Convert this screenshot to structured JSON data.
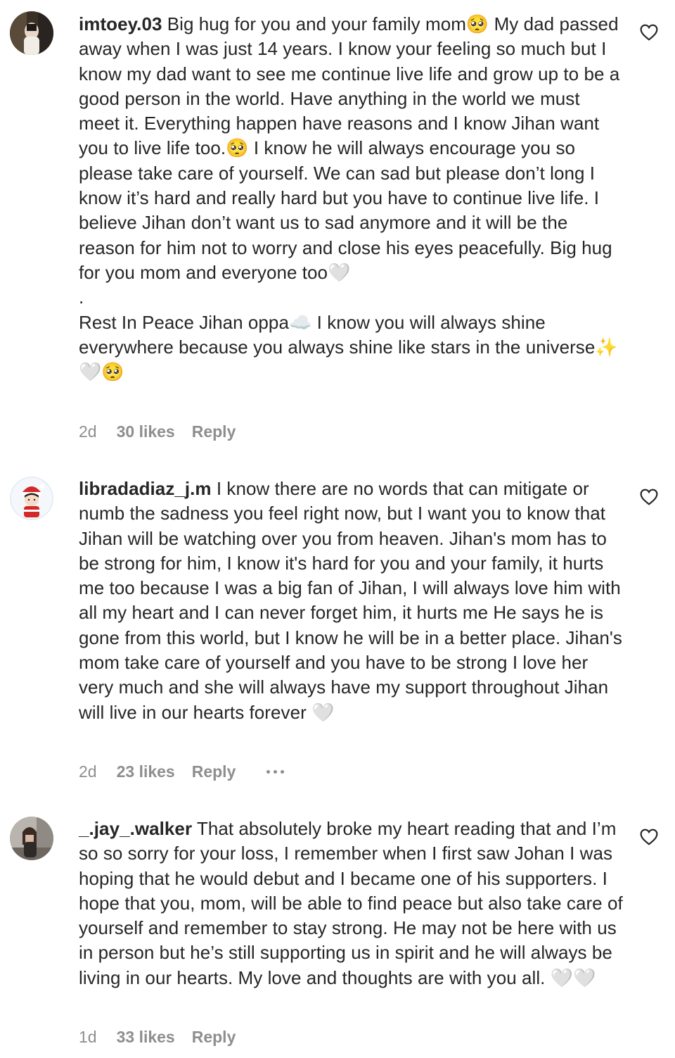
{
  "comments": [
    {
      "username": "imtoey.03",
      "body": " Big hug for you and your family mom🥺 My dad passed away when I was just 14 years. I know your feeling so much but I know my dad want to see me continue live life and grow up to be a good person in the world. Have anything in the world we must meet it. Everything happen have reasons and I know Jihan want you to live life too.🥺 I know he will always encourage you so please take care of yourself. We can sad but please don’t long I know it’s hard and really hard but you have to continue live life. I believe Jihan don’t want us to sad anymore and it will be the reason for him not to worry and close his eyes peacefully. Big hug for you mom and everyone too🤍\n.\nRest In Peace Jihan oppa☁️ I know you will always shine everywhere because you always shine like stars in the universe✨🤍🥺",
      "time": "2d",
      "likes": "30 likes",
      "reply": "Reply"
    },
    {
      "username": "libradadiaz_j.m",
      "body": " I know there are no words that can mitigate or numb the sadness you feel right now, but I want you to know that Jihan will be watching over you from heaven. Jihan's mom has to be strong for him, I know it's hard for you and your family, it hurts me too because I was a big fan of Jihan, I will always love him with all my heart and I can never forget him, it hurts me He says he is gone from this world, but I know he will be in a better place. Jihan's mom take care of yourself and you have to be strong I love her very much and she will always have my support throughout Jihan will live in our hearts forever 🤍",
      "time": "2d",
      "likes": "23 likes",
      "reply": "Reply"
    },
    {
      "username": "_.jay_.walker",
      "body": " That absolutely broke my heart reading that and I’m so so sorry for your loss, I remember when I first saw Johan I was hoping that he would debut and I became one of his supporters. I hope that you, mom, will be able to find peace but also take care of yourself and remember to stay strong. He may not be here with us in person but he’s still supporting us in spirit and he will always be living in our hearts. My love and thoughts are with you all. 🤍🤍",
      "time": "1d",
      "likes": "33 likes",
      "reply": "Reply"
    }
  ],
  "icons": {
    "like": "heart-outline-icon",
    "more": "more-options-icon"
  },
  "colors": {
    "text": "#262626",
    "meta": "#8e8e8e"
  }
}
